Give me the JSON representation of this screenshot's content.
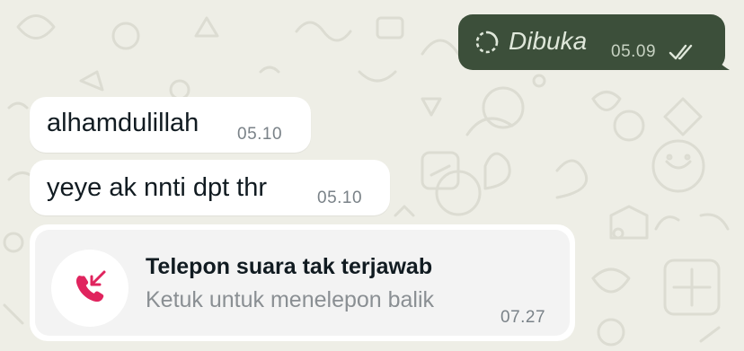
{
  "chat": {
    "outgoing": {
      "status_icon": "view-once-spinner-icon",
      "text": "Dibuka",
      "time": "05.09",
      "ticks_icon": "double-check-icon",
      "bubble_color": "#3c4f3a"
    },
    "incoming": [
      {
        "text": "alhamdulillah",
        "time": "05.10"
      },
      {
        "text": "yeye ak nnti dpt thr",
        "time": "05.10"
      }
    ],
    "missed_call": {
      "icon": "missed-call-icon",
      "title": "Telepon suara tak terjawab",
      "subtitle": "Ketuk untuk menelepon balik",
      "time": "07.27",
      "icon_color": "#e0245e"
    }
  },
  "colors": {
    "wallpaper": "#eeeee6",
    "incoming_bubble": "#ffffff"
  }
}
